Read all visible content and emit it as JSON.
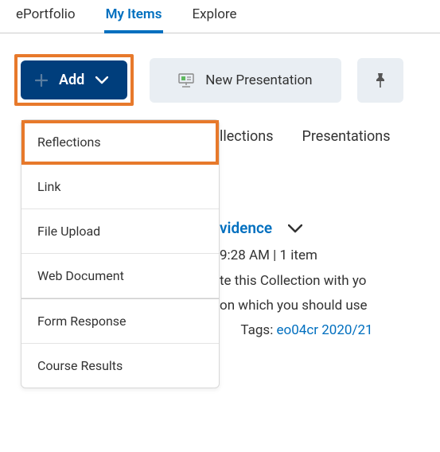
{
  "tabs": {
    "items": [
      {
        "label": "ePortfolio"
      },
      {
        "label": "My Items"
      },
      {
        "label": "Explore"
      }
    ],
    "active_index": 1
  },
  "toolbar": {
    "add_label": "Add",
    "new_presentation_label": "New Presentation"
  },
  "dropdown": {
    "items": [
      {
        "label": "Reflections",
        "highlight": true
      },
      {
        "label": "Link"
      },
      {
        "label": "File Upload"
      },
      {
        "label": "Web Document"
      }
    ],
    "items_b": [
      {
        "label": "Form Response"
      },
      {
        "label": "Course Results"
      }
    ]
  },
  "filters": {
    "a": "llections",
    "b": "Presentations"
  },
  "content": {
    "title_fragment": "vidence",
    "meta": " 9:28 AM | 1 item",
    "desc_line1": "te this Collection with yo",
    "desc_line2": "on which you should use",
    "tags_label": "Tags:",
    "tag_text": "eo04cr 2020/21"
  }
}
